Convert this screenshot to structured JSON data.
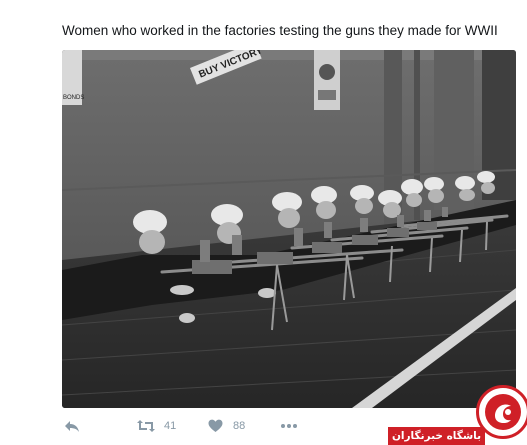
{
  "tweet": {
    "text": "Women who worked in the factories testing the guns they made for WWII"
  },
  "photo": {
    "description_icon": "photo-image",
    "poster_text": "BUY VICTORY",
    "poster_left_text": "BONDS"
  },
  "actions": {
    "reply_icon": "reply-icon",
    "retweet_icon": "retweet-icon",
    "retweet_count": "41",
    "like_icon": "heart-icon",
    "like_count": "88",
    "more_icon": "more-dots-icon"
  },
  "watermark": {
    "label": "باشگاه خبرنگاران"
  },
  "colors": {
    "action_gray": "#8899a6",
    "watermark_red": "#cf2027"
  }
}
